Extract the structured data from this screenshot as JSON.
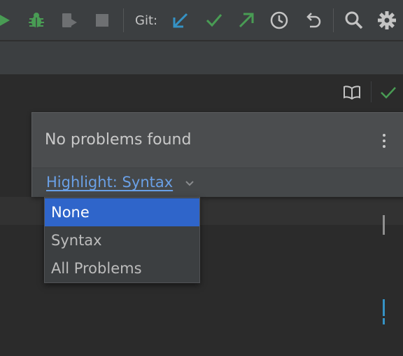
{
  "toolbar": {
    "git_label": "Git:",
    "icons": [
      "run-icon",
      "debug-icon",
      "attach-debugger-icon",
      "stop-icon",
      "git-update-icon",
      "git-commit-icon",
      "git-push-icon",
      "history-icon",
      "rollback-icon",
      "search-icon",
      "settings-icon"
    ]
  },
  "editor": {
    "reader_mode_icon": "book-icon",
    "inspection_icon": "checkmark-icon"
  },
  "problems_popup": {
    "status": "No problems found",
    "highlight_link": "Highlight: Syntax",
    "menu_icon": "more-vertical-icon"
  },
  "highlight_menu": {
    "items": [
      "None",
      "Syntax",
      "All Problems"
    ],
    "selected": "None"
  },
  "colors": {
    "accent_green": "#499c54",
    "accent_blue": "#3592c4",
    "link_blue": "#6aa0e6",
    "selection_blue": "#2f65ca",
    "background": "#2b2b2b",
    "panel": "#3c3f41"
  }
}
